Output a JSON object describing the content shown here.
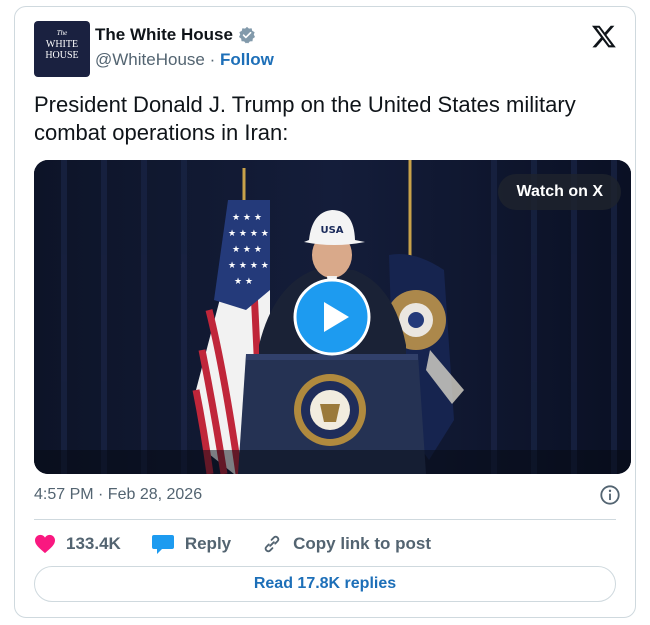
{
  "account": {
    "display_name": "The White House",
    "handle": "@WhiteHouse",
    "separator": "·",
    "follow_label": "Follow",
    "avatar_text_small": "The",
    "avatar_text_line1": "WHITE",
    "avatar_text_line2": "HOUSE",
    "verified": true
  },
  "post": {
    "text": "President Donald J. Trump on the United States military combat operations in Iran:",
    "timestamp": "4:57 PM · Feb 28, 2026"
  },
  "media": {
    "type": "video",
    "watch_label": "Watch on X",
    "cap_text": "USA"
  },
  "actions": {
    "likes": "133.4K",
    "reply_label": "Reply",
    "copy_link_label": "Copy link to post"
  },
  "footer": {
    "read_replies_label": "Read 17.8K replies"
  },
  "colors": {
    "accent": "#1d9bf0",
    "link": "#1d6fb8",
    "like": "#f91880",
    "muted": "#536471",
    "text": "#0f1419",
    "border": "#cfd9de"
  },
  "icons": [
    "verified-badge-icon",
    "x-logo-icon",
    "play-icon",
    "info-icon",
    "heart-icon",
    "reply-bubble-icon",
    "link-icon"
  ]
}
